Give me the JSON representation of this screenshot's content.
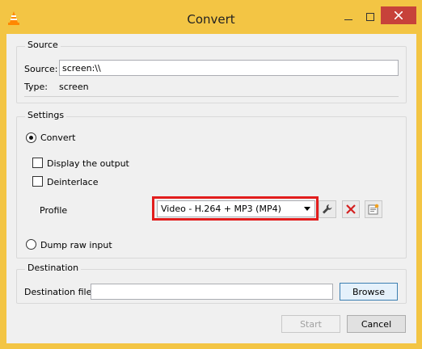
{
  "window": {
    "title": "Convert"
  },
  "source": {
    "group_title": "Source",
    "source_label": "Source:",
    "source_value": "screen:\\\\",
    "type_label": "Type:",
    "type_value": "screen"
  },
  "settings": {
    "group_title": "Settings",
    "convert_label": "Convert",
    "display_output_label": "Display the output",
    "deinterlace_label": "Deinterlace",
    "profile_label": "Profile",
    "profile_selected": "Video - H.264 + MP3 (MP4)",
    "dump_raw_label": "Dump raw input"
  },
  "destination": {
    "group_title": "Destination",
    "file_label": "Destination file:",
    "file_value": "",
    "browse_label": "Browse"
  },
  "footer": {
    "start_label": "Start",
    "cancel_label": "Cancel"
  },
  "icons": {
    "app": "vlc-cone-icon",
    "edit_profile": "wrench-icon",
    "delete_profile": "delete-x-icon",
    "new_profile": "new-profile-icon"
  },
  "colors": {
    "titlebar": "#f3c544",
    "close_button": "#c7423a",
    "highlight": "#e21d1d",
    "delete_x": "#d42020"
  }
}
